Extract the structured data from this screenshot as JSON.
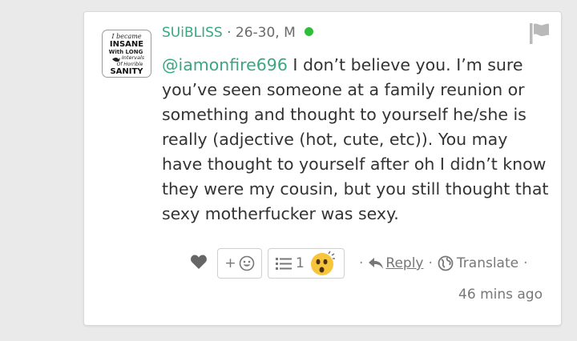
{
  "comment": {
    "avatar_text": [
      "I became",
      "INSANE",
      "With LONG",
      "Intervals",
      "Of Horrible",
      "SANITY"
    ],
    "username": "SUiBLISS",
    "age_gender": "· 26-30, M",
    "online_color": "#2fbe3a",
    "mention": "@iamonfire696",
    "text": " I don’t believe you. I’m sure you’ve seen someone at a family reunion or something and thought to yourself he/she is really (adjective (hot, cute, etc)). You may have thought to yourself after oh I didn’t know they were my cousin, but you still thought that sexy motherfucker was sexy.",
    "reaction_add_label": "+",
    "reaction_count": "1",
    "reply_label": "Reply",
    "translate_label": "Translate",
    "separator": "·",
    "timestamp": "46 mins ago"
  },
  "colors": {
    "accent": "#3aa682",
    "text": "#333333",
    "muted": "#777777"
  }
}
